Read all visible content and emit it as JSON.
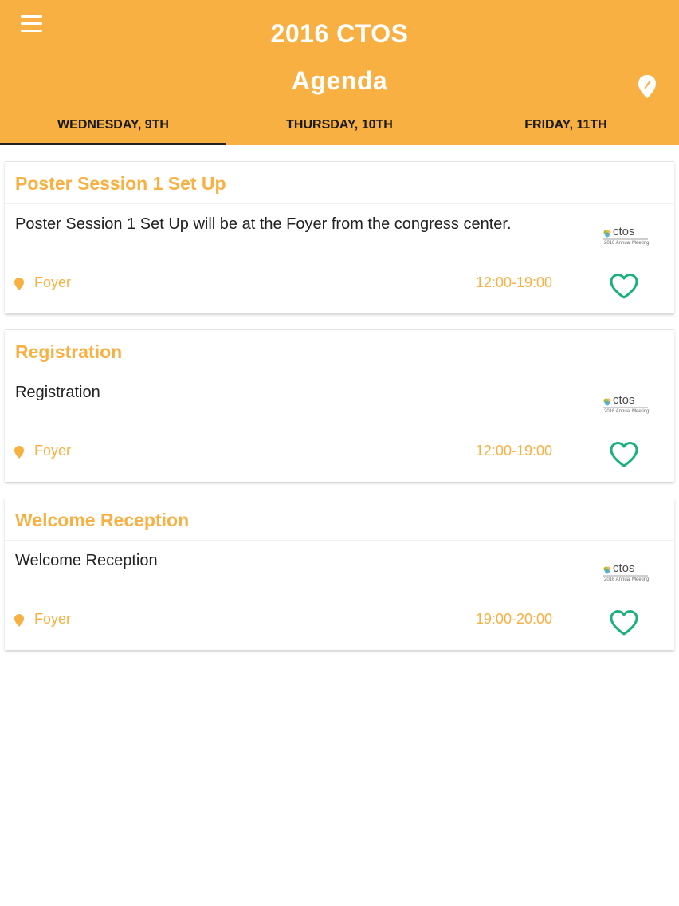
{
  "header": {
    "app_title": "2016 CTOS",
    "page_title": "Agenda",
    "background_color": "#F9B042"
  },
  "tabs": [
    {
      "label": "WEDNESDAY, 9TH",
      "active": true
    },
    {
      "label": "THURSDAY, 10TH",
      "active": false
    },
    {
      "label": "FRIDAY, 11TH",
      "active": false
    }
  ],
  "logo": {
    "text": "ctos",
    "subtitle": "2016 Annual Meeting"
  },
  "sessions": [
    {
      "title": "Poster Session 1 Set Up",
      "description": "Poster Session 1 Set Up will be at the Foyer from the congress center.",
      "location": "Foyer",
      "time": "12:00-19:00",
      "favorited": false
    },
    {
      "title": "Registration",
      "description": "Registration",
      "location": "Foyer",
      "time": "12:00-19:00",
      "favorited": false
    },
    {
      "title": "Welcome Reception",
      "description": "Welcome Reception",
      "location": "Foyer",
      "time": "19:00-20:00",
      "favorited": false
    }
  ],
  "colors": {
    "accent": "#F9B042",
    "favorite": "#1DB07F",
    "text": "#222222"
  },
  "icons": {
    "menu": "hamburger-menu-icon",
    "map": "map-pin-icon",
    "location": "location-pin-icon",
    "favorite": "heart-outline-icon"
  }
}
